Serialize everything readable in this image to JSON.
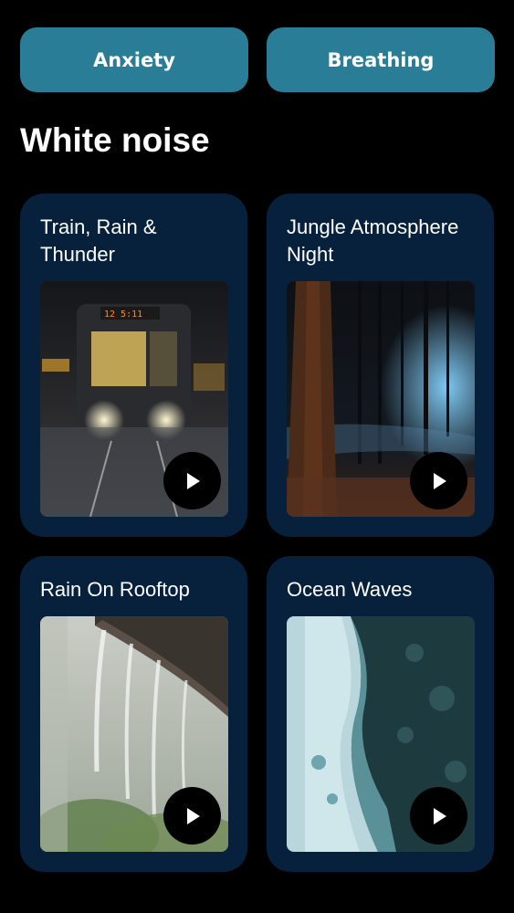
{
  "chips": [
    {
      "label": "Anxiety"
    },
    {
      "label": "Breathing"
    }
  ],
  "section": {
    "title": "White noise"
  },
  "cards": [
    {
      "title": "Train, Rain & Thunder",
      "thumb": "train-rain-image",
      "play_icon": "play-icon"
    },
    {
      "title": "Jungle Atmosphere Night",
      "thumb": "night-forest-image",
      "play_icon": "play-icon"
    },
    {
      "title": "Rain On Rooftop",
      "thumb": "rooftop-rain-image",
      "play_icon": "play-icon"
    },
    {
      "title": "Ocean Waves",
      "thumb": "ocean-waves-image",
      "play_icon": "play-icon"
    }
  ],
  "colors": {
    "background": "#000000",
    "chip": "#2a7d97",
    "card": "#07213d",
    "play_button": "#000000"
  }
}
